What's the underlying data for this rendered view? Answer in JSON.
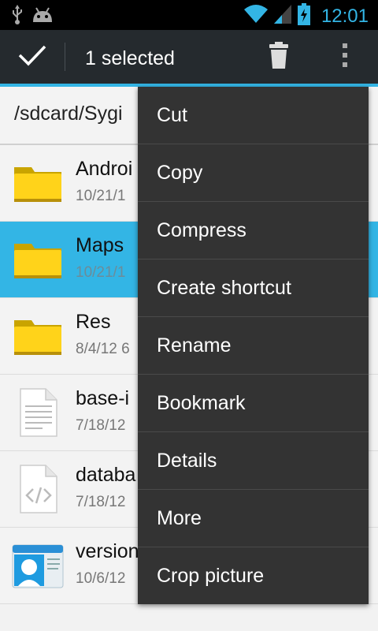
{
  "status_bar": {
    "time": "12:01",
    "icons": [
      "usb-icon",
      "android-icon",
      "wifi-icon",
      "signal-icon",
      "battery-charging-icon"
    ]
  },
  "action_bar": {
    "title": "1 selected",
    "icons": [
      "check-icon",
      "trash-icon",
      "overflow-menu-icon"
    ]
  },
  "path_bar": {
    "path": "/sdcard/Sygi"
  },
  "files": [
    {
      "name": "Androi",
      "meta": "10/21/1",
      "icon": "folder-icon",
      "selected": false
    },
    {
      "name": "Maps",
      "meta": "10/21/1",
      "icon": "folder-icon",
      "selected": true
    },
    {
      "name": "Res",
      "meta": "8/4/12 6",
      "icon": "folder-icon",
      "selected": false
    },
    {
      "name": "base-i",
      "meta": "7/18/12",
      "icon": "text-file-icon",
      "selected": false
    },
    {
      "name": "databa",
      "meta": "7/18/12",
      "icon": "xml-file-icon",
      "selected": false
    },
    {
      "name": "version",
      "meta": "10/6/12",
      "icon": "contact-card-icon",
      "selected": false
    }
  ],
  "menu": {
    "items": [
      "Cut",
      "Copy",
      "Compress",
      "Create shortcut",
      "Rename",
      "Bookmark",
      "Details",
      "More",
      "Crop picture"
    ]
  },
  "colors": {
    "accent": "#33b5e5",
    "action_bar": "#252a2e",
    "menu_bg": "#333333"
  }
}
